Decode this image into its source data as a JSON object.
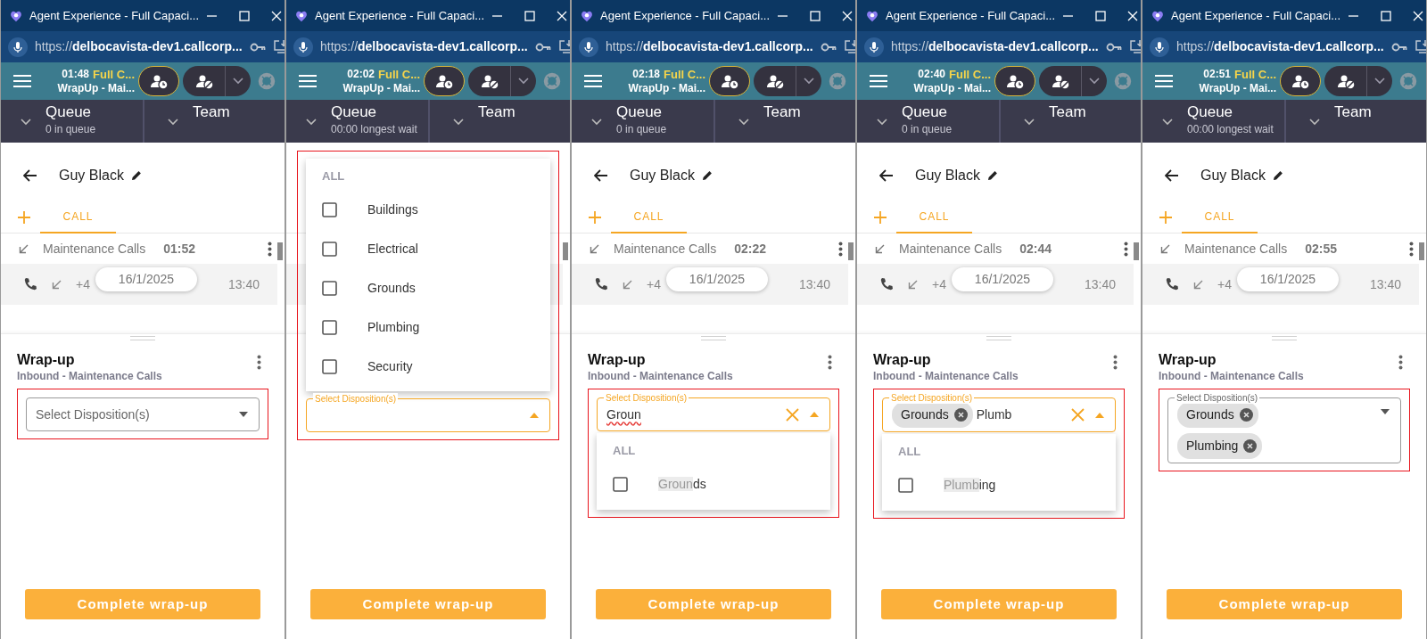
{
  "panels": [
    {
      "window": {
        "title": "Agent Experience - Full Capaci...",
        "url": "https://**delbocavista-dev1.callcorp...**"
      },
      "agent": {
        "timer": "01:48",
        "status": "Full C...",
        "activity": "WrapUp - Mai..."
      },
      "queue": {
        "label": "Queue",
        "detail": "0 in queue"
      },
      "team": {
        "label": "Team"
      },
      "contact": {
        "name": "Guy Black",
        "tab": "CALL",
        "queue_name": "Maintenance Calls",
        "duration": "01:52",
        "number": "+4",
        "date": "16/1/2025",
        "time": "13:40"
      },
      "wrapup": {
        "title": "Wrap-up",
        "subtitle": "Inbound - Maintenance Calls"
      },
      "field": {
        "placeholder": "Select Disposition(s)",
        "focused": false,
        "open": false,
        "clearable": false
      },
      "button": "Complete wrap-up"
    },
    {
      "window": {
        "title": "Agent Experience - Full Capaci...",
        "url": "https://**delbocavista-dev1.callcorp...**"
      },
      "agent": {
        "timer": "02:02",
        "status": "Full C...",
        "activity": "WrapUp - Mai..."
      },
      "queue": {
        "label": "Queue",
        "detail": "00:00 longest wait"
      },
      "team": {
        "label": "Team"
      },
      "field": {
        "label": "Select Disposition(s)",
        "focused": true,
        "open": true,
        "clearable": false
      },
      "dropdown": {
        "above": true,
        "header": "ALL",
        "options": [
          {
            "checked": false,
            "parts": [
              {
                "text": "Buildings",
                "highlighted": false
              }
            ]
          },
          {
            "checked": false,
            "parts": [
              {
                "text": "Electrical",
                "highlighted": false
              }
            ]
          },
          {
            "checked": false,
            "parts": [
              {
                "text": "Grounds",
                "highlighted": false
              }
            ]
          },
          {
            "checked": false,
            "parts": [
              {
                "text": "Plumbing",
                "highlighted": false
              }
            ]
          },
          {
            "checked": false,
            "parts": [
              {
                "text": "Security",
                "highlighted": false
              }
            ]
          }
        ]
      },
      "button": "Complete wrap-up"
    },
    {
      "window": {
        "title": "Agent Experience - Full Capaci...",
        "url": "https://**delbocavista-dev1.callcorp...**"
      },
      "agent": {
        "timer": "02:18",
        "status": "Full C...",
        "activity": "WrapUp - Mai..."
      },
      "queue": {
        "label": "Queue",
        "detail": "0 in queue"
      },
      "team": {
        "label": "Team"
      },
      "contact": {
        "name": "Guy Black",
        "tab": "CALL",
        "queue_name": "Maintenance Calls",
        "duration": "02:22",
        "number": "+4",
        "date": "16/1/2025",
        "time": "13:40"
      },
      "wrapup": {
        "title": "Wrap-up",
        "subtitle": "Inbound - Maintenance Calls"
      },
      "field": {
        "label": "Select Disposition(s)",
        "value": "Groun",
        "spelling_error": true,
        "focused": true,
        "open": true,
        "clearable": true
      },
      "dropdown": {
        "above": false,
        "header": "ALL",
        "options": [
          {
            "checked": false,
            "parts": [
              {
                "text": "Groun",
                "highlighted": true
              },
              {
                "text": "ds",
                "highlighted": false
              }
            ]
          }
        ]
      },
      "button": "Complete wrap-up"
    },
    {
      "window": {
        "title": "Agent Experience - Full Capaci...",
        "url": "https://**delbocavista-dev1.callcorp...**"
      },
      "agent": {
        "timer": "02:40",
        "status": "Full C...",
        "activity": "WrapUp - Mai..."
      },
      "queue": {
        "label": "Queue",
        "detail": "0 in queue"
      },
      "team": {
        "label": "Team"
      },
      "contact": {
        "name": "Guy Black",
        "tab": "CALL",
        "queue_name": "Maintenance Calls",
        "duration": "02:44",
        "number": "+4",
        "date": "16/1/2025",
        "time": "13:40"
      },
      "wrapup": {
        "title": "Wrap-up",
        "subtitle": "Inbound - Maintenance Calls"
      },
      "field": {
        "label": "Select Disposition(s)",
        "chips": [
          "Grounds"
        ],
        "value": "Plumb",
        "focused": true,
        "open": true,
        "clearable": true
      },
      "dropdown": {
        "above": false,
        "header": "ALL",
        "options": [
          {
            "checked": false,
            "parts": [
              {
                "text": "Plumb",
                "highlighted": true
              },
              {
                "text": "ing",
                "highlighted": false
              }
            ]
          }
        ]
      },
      "button": "Complete wrap-up"
    },
    {
      "window": {
        "title": "Agent Experience - Full Capaci...",
        "url": "https://**delbocavista-dev1.callcorp...**"
      },
      "agent": {
        "timer": "02:51",
        "status": "Full C...",
        "activity": "WrapUp - Mai..."
      },
      "queue": {
        "label": "Queue",
        "detail": "00:00 longest wait"
      },
      "team": {
        "label": "Team"
      },
      "contact": {
        "name": "Guy Black",
        "tab": "CALL",
        "queue_name": "Maintenance Calls",
        "duration": "02:55",
        "number": "+4",
        "date": "16/1/2025",
        "time": "13:40"
      },
      "wrapup": {
        "title": "Wrap-up",
        "subtitle": "Inbound - Maintenance Calls"
      },
      "field": {
        "label": "Select Disposition(s)",
        "chips": [
          "Grounds",
          "Plumbing"
        ],
        "focused": false,
        "open": false,
        "clearable": false
      },
      "button": "Complete wrap-up"
    }
  ]
}
